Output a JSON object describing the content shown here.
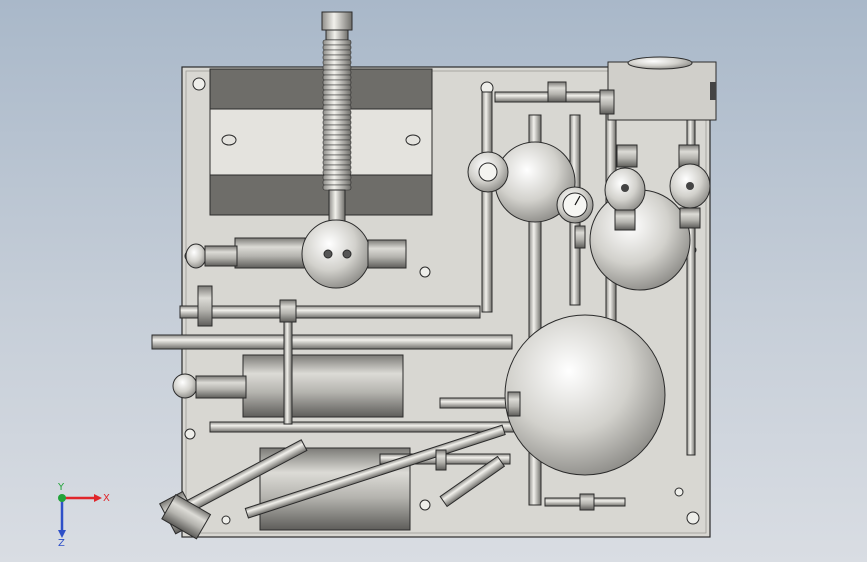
{
  "title": "",
  "triad": {
    "x_label": "X",
    "y_label": "Y",
    "z_label": "Z",
    "x_color": "#e0262b",
    "y_color": "#22a33a",
    "z_color": "#2e50c8"
  },
  "colors": {
    "background_top": "#a9b8c9",
    "background_bottom": "#d9dde3",
    "panel": "#d8d7d2",
    "metal": "#c9c8c4",
    "outline": "#2b2b2b"
  },
  "gauge_labels": {
    "top": "",
    "bottom": ""
  }
}
